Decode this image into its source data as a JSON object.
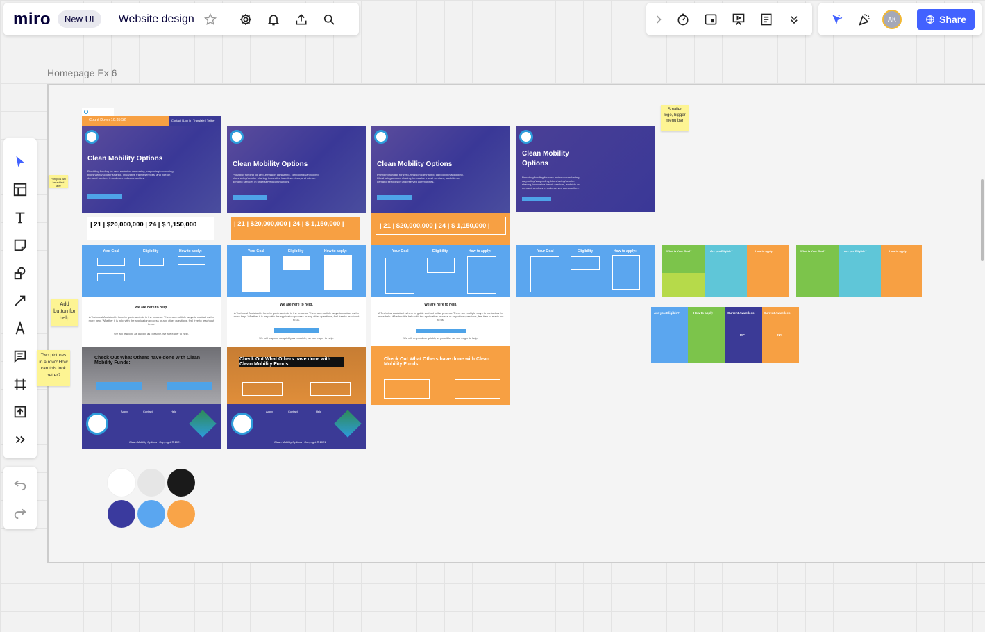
{
  "app": {
    "logo": "miro",
    "badge": "New UI",
    "board_name": "Website design",
    "share_label": "Share",
    "avatar_initials": "AK",
    "accent_color": "#4262ff"
  },
  "frame": {
    "title": "Homepage Ex 6"
  },
  "mockups": {
    "countdown": "Count Down 10:35:52",
    "top_links": "Contact | Log in | Translate | Twitter",
    "hero_title": "Clean Mobility Options",
    "hero_title_line1": "Clean Mobility",
    "hero_title_line2": "Options",
    "hero_text": "Providing funding for zero-emission carsharing, carpooling/vanpooling, bikesharing/scooter sharing, innovative transit services, and ride-on demand services in underserved communities.",
    "learn_more": "Learn more",
    "stats_line": "| 21 | $20,000,000 | 24 | $ 1,150,000 |",
    "stats_line_short": "| 21 | $20,000,000 | 24 | $ 1,150,000",
    "goal_header": "Your Goal",
    "eligibility_header": "Eligibility",
    "how_apply_header": "How to apply:",
    "help_heading": "We are here to help.",
    "help_text": "A Technical Assistant is here to guide and aid in the process. There are multiple ways to contact us for more help. Whether it is help with the application process or any other questions, feel free to reach out to us.",
    "help_text2": "We will respond as quickly as possible, we are eager to help.",
    "check_out": "Check Out What Others have done with Clean Mobility Funds:",
    "mobility_projects": "Mobility Project Awardees",
    "voucher_awardees": "View Voucher Awardees",
    "footer_copyright": "Clean Mobility Options | Copyright © 2021",
    "footer_apply": "Apply",
    "footer_contact": "Contact",
    "footer_help": "Help",
    "what_goal": "What is Your Goal?",
    "are_eligible": "Are you Eligible?",
    "how_apply": "How to apply",
    "current_awardees": "Current Awardees",
    "mp": "MP",
    "na": "NA"
  },
  "stickies": [
    "Smaller logo, bigger menu bar",
    "Fun pics will be added later",
    "Add button for help",
    "Two pictures in a row? How can this look better?"
  ],
  "palette": {
    "colors": [
      "#ffffff",
      "#e6e6e6",
      "#1a1a1a",
      "#3a3a9e",
      "#5aa6f0",
      "#f9a448"
    ]
  },
  "icons": {
    "settings": "gear-icon",
    "notifications": "bell-icon",
    "export": "upload-icon",
    "search": "search-icon",
    "timer": "timer-icon",
    "frames": "frames-icon",
    "present": "presentation-icon",
    "notes": "notes-icon",
    "more": "chevron-double-down-icon",
    "cursor_hand": "cursor-icon",
    "reactions": "party-icon"
  }
}
